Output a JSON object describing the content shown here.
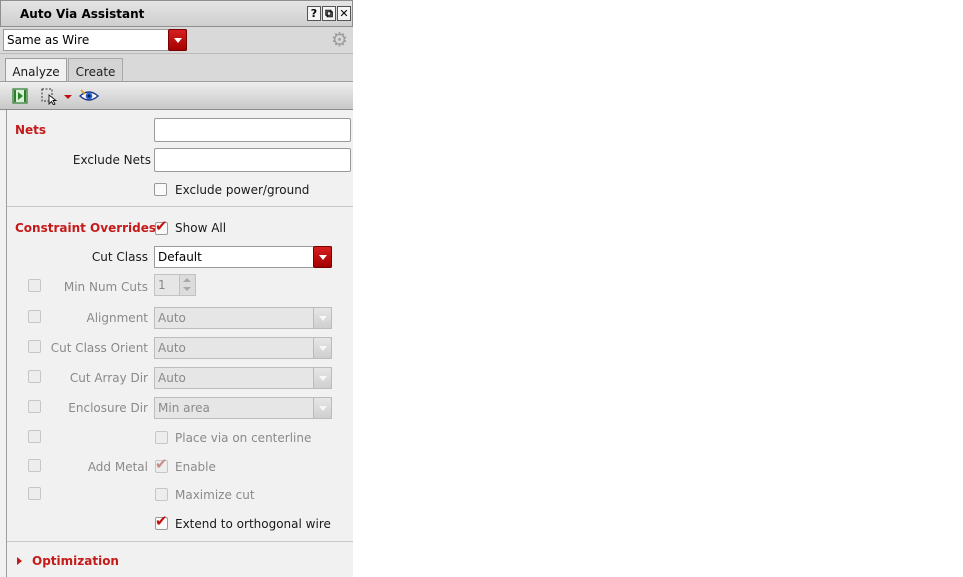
{
  "window": {
    "title": "Auto Via Assistant",
    "buttons": {
      "help": "?",
      "float": "⧉",
      "close": "✕"
    }
  },
  "wire_mode": {
    "value": "Same as Wire"
  },
  "tabs": [
    {
      "label": "Analyze",
      "active": true
    },
    {
      "label": "Create",
      "active": false
    }
  ],
  "toolbar": {
    "icons": [
      "run-analysis-icon",
      "select-area-icon",
      "dropdown-arrow-icon",
      "visibility-eye-icon"
    ]
  },
  "nets": {
    "title": "Nets",
    "nets_value": "",
    "exclude_label": "Exclude Nets",
    "exclude_value": "",
    "exclude_power_label": "Exclude power/ground",
    "exclude_power_checked": false
  },
  "constraints": {
    "title": "Constraint Overrides",
    "show_all_label": "Show All",
    "show_all_checked": true,
    "cut_class_label": "Cut Class",
    "cut_class_value": "Default",
    "min_num_cuts_label": "Min Num Cuts",
    "min_num_cuts_value": "1",
    "alignment_label": "Alignment",
    "alignment_value": "Auto",
    "cut_class_orient_label": "Cut Class Orient",
    "cut_class_orient_value": "Auto",
    "cut_array_dir_label": "Cut Array Dir",
    "cut_array_dir_value": "Auto",
    "enclosure_dir_label": "Enclosure Dir",
    "enclosure_dir_value": "Min area",
    "place_centerline_label": "Place via on centerline",
    "add_metal_label": "Add Metal",
    "enable_label": "Enable",
    "enable_checked": true,
    "maximize_cut_label": "Maximize cut",
    "extend_label": "Extend to orthogonal wire",
    "extend_checked": true
  },
  "optimization": {
    "title": "Optimization",
    "expanded": false
  },
  "colors": {
    "accent": "#c41a1a",
    "dropdown_arrow": "#b80f0f",
    "panel_bg": "#f1f1f1"
  }
}
